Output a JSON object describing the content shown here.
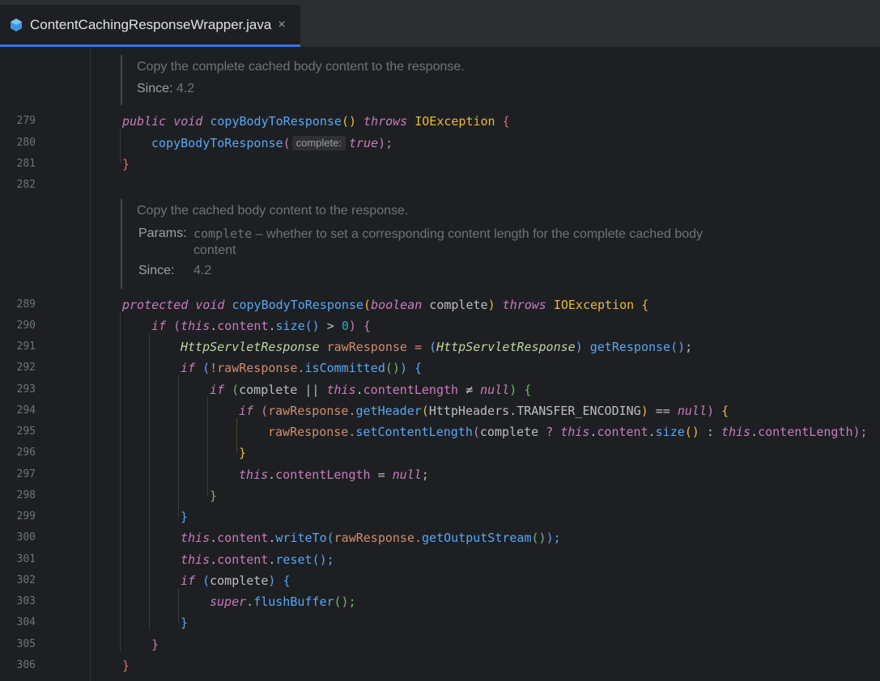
{
  "tab": {
    "title": "ContentCachingResponseWrapper.java",
    "close": "×",
    "icon": "java-class-icon"
  },
  "doc1": {
    "description": "Copy the complete cached body content to the response.",
    "since_label": "Since:",
    "since_value": "4.2"
  },
  "doc2": {
    "description": "Copy the cached body content to the response.",
    "params_label": "Params:",
    "param_name": "complete",
    "param_desc_1": "– whether to set a corresponding content length for the complete cached body",
    "param_desc_2": "content",
    "since_label": "Since:",
    "since_value": "4.2"
  },
  "inlay_hint": "complete:",
  "lines": [
    "279",
    "280",
    "281",
    "282",
    "289",
    "290",
    "291",
    "292",
    "293",
    "294",
    "295",
    "296",
    "297",
    "298",
    "299",
    "300",
    "301",
    "302",
    "303",
    "304",
    "305",
    "306"
  ],
  "code": {
    "l279": [
      "public",
      " ",
      "void",
      " ",
      "copyBodyToResponse",
      "()",
      " ",
      "throws",
      " ",
      "IOException",
      " ",
      "{"
    ],
    "l280": [
      "copyBodyToResponse",
      "(",
      "true",
      ");"
    ],
    "l281": [
      "}"
    ],
    "l289": [
      "protected",
      " ",
      "void",
      " ",
      "copyBodyToResponse",
      "(",
      "boolean",
      " complete",
      ")",
      " ",
      "throws",
      " ",
      "IOException",
      " ",
      "{"
    ],
    "l290": [
      "if",
      " ",
      "(",
      "this",
      ".",
      "content",
      ".",
      "size",
      "()",
      " > ",
      "0",
      ")",
      " ",
      "{"
    ],
    "l291": [
      "HttpServletResponse",
      " rawResponse = ",
      "(",
      "HttpServletResponse",
      ")",
      " ",
      "getResponse",
      "()",
      ";"
    ],
    "l292": [
      "if",
      " ",
      "(",
      "!rawResponse.",
      "isCommitted",
      "()",
      ")",
      " ",
      "{"
    ],
    "l293": [
      "if",
      " ",
      "(",
      "complete || ",
      "this",
      ".",
      "contentLength",
      " ≠ ",
      "null",
      ")",
      " ",
      "{"
    ],
    "l294": [
      "if",
      " ",
      "(",
      "rawResponse.",
      "getHeader",
      "(",
      "HttpHeaders.",
      "TRANSFER_ENCODING",
      ")",
      " == ",
      "null",
      ")",
      " ",
      "{"
    ],
    "l295": [
      "rawResponse.",
      "setContentLength",
      "(",
      "complete ",
      "?",
      " ",
      "this",
      ".",
      "content",
      ".",
      "size",
      "()",
      " : ",
      "this",
      ".",
      "contentLength",
      ");"
    ],
    "l296": [
      "}"
    ],
    "l297": [
      "this",
      ".",
      "contentLength",
      " = ",
      "null",
      ";"
    ],
    "l298": [
      "}"
    ],
    "l299": [
      "}"
    ],
    "l300": [
      "this",
      ".",
      "content",
      ".",
      "writeTo",
      "(",
      "rawResponse.",
      "getOutputStream",
      "()",
      ");"
    ],
    "l301": [
      "this",
      ".",
      "content",
      ".",
      "reset",
      "();"
    ],
    "l302": [
      "if",
      " ",
      "(",
      "complete",
      ")",
      " ",
      "{"
    ],
    "l303": [
      "super",
      ".",
      "flushBuffer",
      "();"
    ],
    "l304": [
      "}"
    ],
    "l305": [
      "}"
    ],
    "l306": [
      "}"
    ]
  }
}
